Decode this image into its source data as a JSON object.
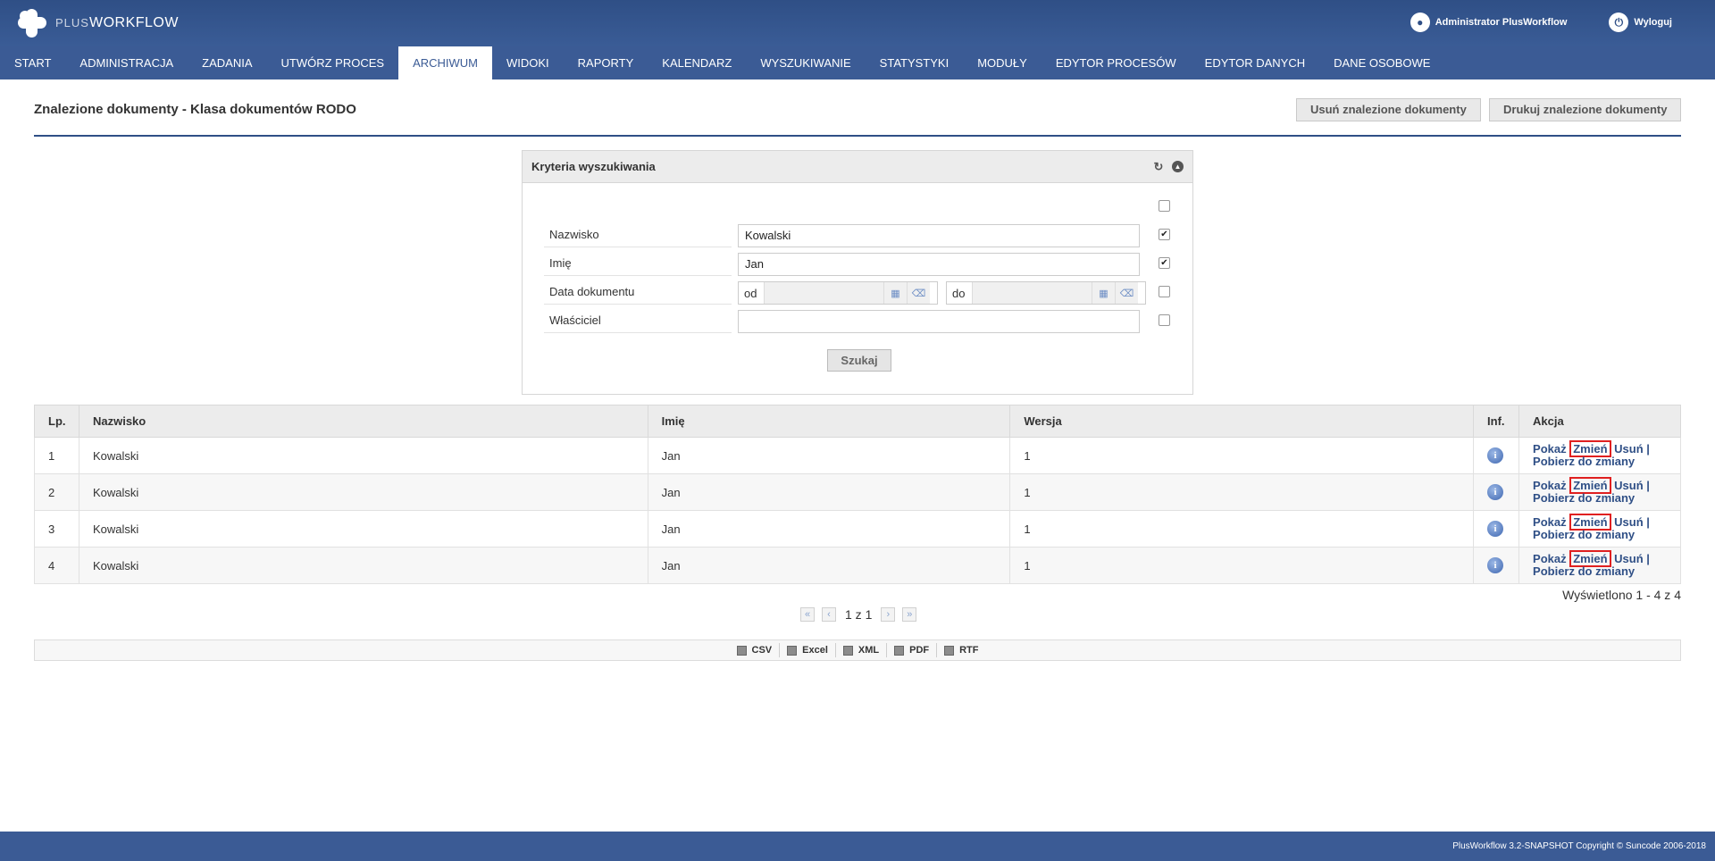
{
  "app": {
    "logo_plus": "PLUS",
    "logo_workflow": "WORKFLOW"
  },
  "user_area": {
    "user_name": "Administrator PlusWorkflow",
    "logout_label": "Wyloguj"
  },
  "nav": {
    "items": [
      "START",
      "ADMINISTRACJA",
      "ZADANIA",
      "UTWÓRZ PROCES",
      "ARCHIWUM",
      "WIDOKI",
      "RAPORTY",
      "KALENDARZ",
      "WYSZUKIWANIE",
      "STATYSTYKI",
      "MODUŁY",
      "EDYTOR PROCESÓW",
      "EDYTOR DANYCH",
      "DANE OSOBOWE"
    ],
    "active": "ARCHIWUM"
  },
  "page": {
    "title": "Znalezione dokumenty - Klasa dokumentów RODO",
    "delete_found_label": "Usuń znalezione dokumenty",
    "print_found_label": "Drukuj znalezione dokumenty"
  },
  "search_panel": {
    "title": "Kryteria wyszukiwania",
    "fields": [
      {
        "label": "Nazwisko",
        "value": "Kowalski",
        "checked": true
      },
      {
        "label": "Imię",
        "value": "Jan",
        "checked": true
      },
      {
        "label": "Data dokumentu",
        "from_label": "od",
        "to_label": "do",
        "checked": false
      },
      {
        "label": "Właściciel",
        "value": "",
        "checked": false
      }
    ],
    "select_all_checked": false,
    "search_button": "Szukaj"
  },
  "results": {
    "columns": [
      "Lp.",
      "Nazwisko",
      "Imię",
      "Wersja",
      "Inf.",
      "Akcja"
    ],
    "rows": [
      {
        "lp": "1",
        "nazwisko": "Kowalski",
        "imie": "Jan",
        "wersja": "1"
      },
      {
        "lp": "2",
        "nazwisko": "Kowalski",
        "imie": "Jan",
        "wersja": "1"
      },
      {
        "lp": "3",
        "nazwisko": "Kowalski",
        "imie": "Jan",
        "wersja": "1"
      },
      {
        "lp": "4",
        "nazwisko": "Kowalski",
        "imie": "Jan",
        "wersja": "1"
      }
    ],
    "actions": {
      "show": "Pokaż",
      "change": "Zmień",
      "delete": "Usuń",
      "download": "Pobierz do zmiany",
      "separator": "|"
    },
    "summary": "Wyświetlono 1 - 4 z 4"
  },
  "pager": {
    "text": "1 z 1"
  },
  "export": {
    "items": [
      "CSV",
      "Excel",
      "XML",
      "PDF",
      "RTF"
    ]
  },
  "footer": {
    "text": "PlusWorkflow 3.2-SNAPSHOT Copyright © Suncode 2006-2018"
  },
  "colors": {
    "brand": "#3b5b95",
    "highlight": "#e02020"
  }
}
